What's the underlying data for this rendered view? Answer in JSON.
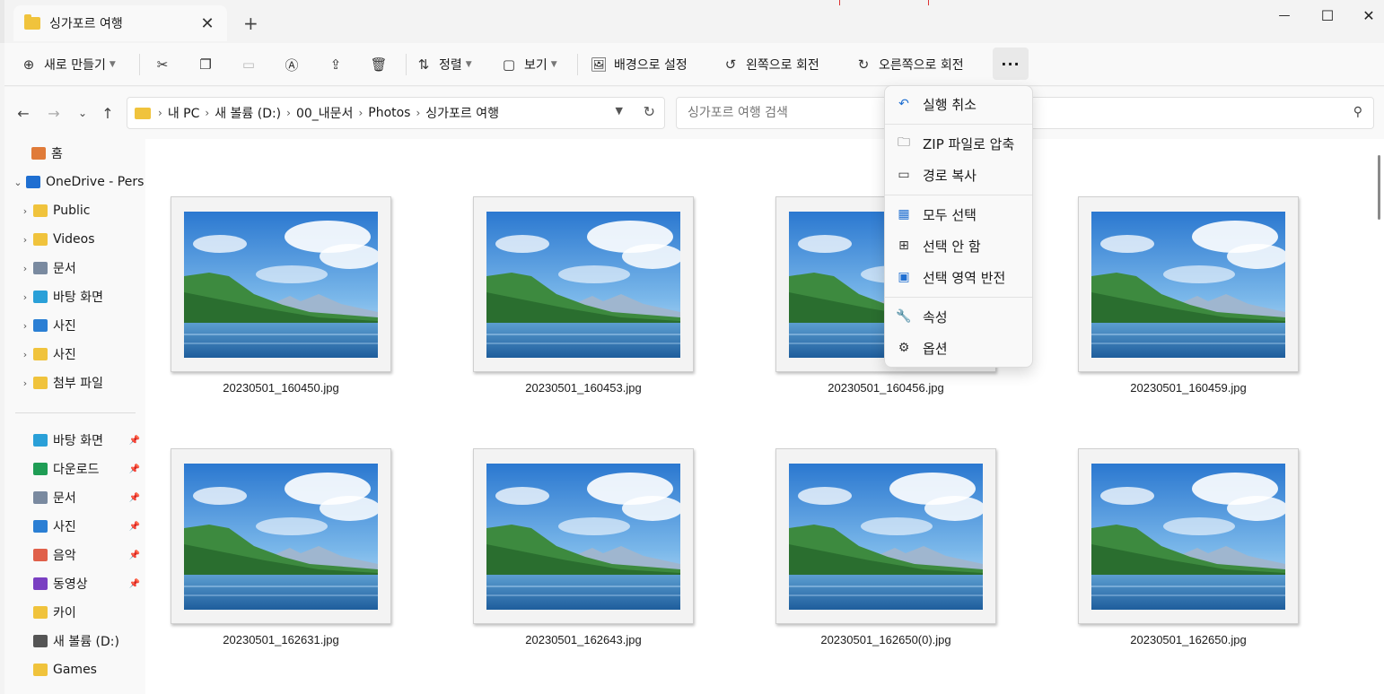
{
  "window": {
    "tab_title": "싱가포르 여행",
    "tab_close": "✕",
    "new_tab": "+",
    "minimize": "—",
    "maximize": "☐",
    "close": "✕"
  },
  "toolbar": {
    "new_label": "새로 만들기",
    "sort_label": "정렬",
    "view_label": "보기",
    "set_background_label": "배경으로 설정",
    "rotate_left_label": "왼쪽으로 회전",
    "rotate_right_label": "오른쪽으로 회전",
    "more_label": "···"
  },
  "address": {
    "crumbs": [
      "내 PC",
      "새 볼륨 (D:)",
      "00_내문서",
      "Photos",
      "싱가포르 여행"
    ],
    "search_placeholder": "싱가포르 여행 검색"
  },
  "sidebar": {
    "items": [
      {
        "label": "홈",
        "icon": "home-icon",
        "color": "#e07b39"
      },
      {
        "label": "OneDrive - Pers",
        "icon": "onedrive-icon",
        "color": "#1f6fd1"
      },
      {
        "label": "Public",
        "icon": "folder-icon",
        "color": "#f0c33c"
      },
      {
        "label": "Videos",
        "icon": "folder-icon",
        "color": "#f0c33c"
      },
      {
        "label": "문서",
        "icon": "document-icon",
        "color": "#7a8aa0"
      },
      {
        "label": "바탕 화면",
        "icon": "desktop-icon",
        "color": "#2aa0d8"
      },
      {
        "label": "사진",
        "icon": "pictures-icon",
        "color": "#2b7fd4"
      },
      {
        "label": "사진",
        "icon": "folder-icon",
        "color": "#f0c33c"
      },
      {
        "label": "첨부 파일",
        "icon": "folder-icon",
        "color": "#f0c33c"
      }
    ],
    "quick": [
      {
        "label": "바탕 화면",
        "icon": "desktop-icon",
        "color": "#2aa0d8",
        "pinned": true
      },
      {
        "label": "다운로드",
        "icon": "download-icon",
        "color": "#1f9d55",
        "pinned": true
      },
      {
        "label": "문서",
        "icon": "document-icon",
        "color": "#7a8aa0",
        "pinned": true
      },
      {
        "label": "사진",
        "icon": "pictures-icon",
        "color": "#2b7fd4",
        "pinned": true
      },
      {
        "label": "음악",
        "icon": "music-icon",
        "color": "#e0604a",
        "pinned": true
      },
      {
        "label": "동영상",
        "icon": "video-icon",
        "color": "#7a3fc2",
        "pinned": true
      },
      {
        "label": "카이",
        "icon": "folder-icon",
        "color": "#f0c33c",
        "pinned": false
      },
      {
        "label": "새 볼륨 (D:)",
        "icon": "drive-icon",
        "color": "#555555",
        "pinned": false
      },
      {
        "label": "Games",
        "icon": "folder-icon",
        "color": "#f0c33c",
        "pinned": false
      }
    ]
  },
  "files": [
    "20230501_160450.jpg",
    "20230501_160453.jpg",
    "20230501_160456.jpg",
    "20230501_160459.jpg",
    "20230501_162631.jpg",
    "20230501_162643.jpg",
    "20230501_162650(0).jpg",
    "20230501_162650.jpg"
  ],
  "menu": {
    "undo": "실행 취소",
    "zip": "ZIP 파일로 압축",
    "copy_path": "경로 복사",
    "select_all": "모두 선택",
    "select_none": "선택 안 함",
    "invert_selection": "선택 영역 반전",
    "properties": "속성",
    "options": "옵션"
  }
}
